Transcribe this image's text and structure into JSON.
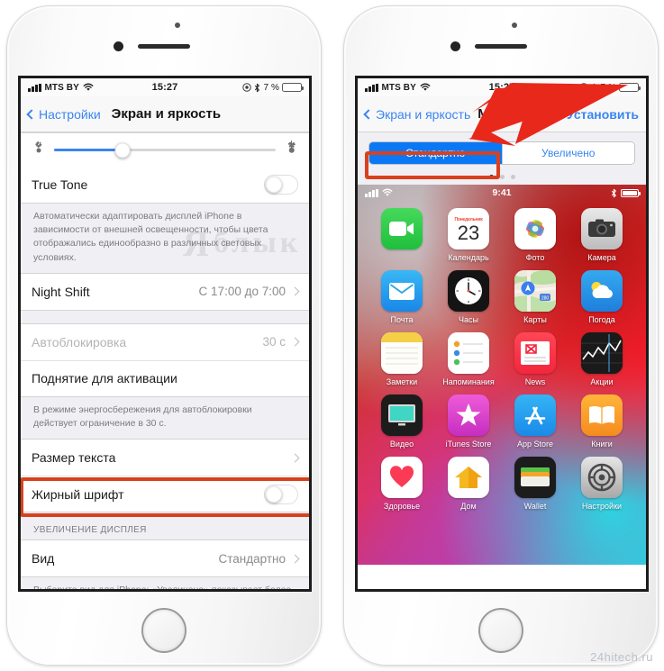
{
  "left_phone": {
    "status_bar": {
      "carrier": "MTS BY",
      "time": "15:27",
      "battery_pct": "7 %"
    },
    "nav": {
      "back_label": "Настройки",
      "title": "Экран и яркость"
    },
    "brightness": {
      "value_pct": 31,
      "low_icon": "sun-small-icon",
      "high_icon": "sun-large-icon"
    },
    "rows": {
      "true_tone": {
        "label": "True Tone",
        "toggle": "off"
      },
      "true_tone_note": "Автоматически адаптировать дисплей iPhone в зависимости от внешней освещенности, чтобы цвета отображались единообразно в различных световых условиях.",
      "night_shift": {
        "label": "Night Shift",
        "value": "С 17:00 до 7:00"
      },
      "autolock": {
        "label": "Автоблокировка",
        "value": "30 с"
      },
      "raise_to_wake": {
        "label": "Поднятие для активации"
      },
      "autolock_note": "В режиме энергосбережения для автоблокировки действует ограничение в 30 с.",
      "text_size": {
        "label": "Размер текста"
      },
      "bold_text": {
        "label": "Жирный шрифт",
        "toggle": "off"
      },
      "zoom_header": "УВЕЛИЧЕНИЕ ДИСПЛЕЯ",
      "view": {
        "label": "Вид",
        "value": "Стандартно"
      },
      "view_note": "Выберите вид для iPhone: «Увеличено» показывает более крупно элементы управления, «Стандартно» — больше контента."
    }
  },
  "right_phone": {
    "status_bar": {
      "carrier": "MTS BY",
      "time": "15:27",
      "battery_pct": "7 %"
    },
    "nav": {
      "back_label": "Экран и яркость",
      "title": "Масштаб",
      "action": "Установить"
    },
    "segmented": {
      "options": [
        "Стандартно",
        "Увеличено"
      ],
      "selected_index": 0
    },
    "page_dots": {
      "count": 3,
      "active_index": 0
    },
    "home_preview": {
      "status_bar": {
        "time": "9:41"
      },
      "apps": [
        {
          "label": "",
          "icon": "facetime-icon"
        },
        {
          "label": "Календарь",
          "icon": "calendar-icon",
          "day": "23",
          "month": "Понедельник"
        },
        {
          "label": "Фото",
          "icon": "photos-icon"
        },
        {
          "label": "Камера",
          "icon": "camera-icon"
        },
        {
          "label": "Почта",
          "icon": "mail-icon"
        },
        {
          "label": "Часы",
          "icon": "clock-icon"
        },
        {
          "label": "Карты",
          "icon": "maps-icon"
        },
        {
          "label": "Погода",
          "icon": "weather-icon"
        },
        {
          "label": "Заметки",
          "icon": "notes-icon"
        },
        {
          "label": "Напоминания",
          "icon": "reminders-icon"
        },
        {
          "label": "News",
          "icon": "news-icon"
        },
        {
          "label": "Акции",
          "icon": "stocks-icon"
        },
        {
          "label": "Видео",
          "icon": "videos-icon"
        },
        {
          "label": "iTunes Store",
          "icon": "itunes-store-icon"
        },
        {
          "label": "App Store",
          "icon": "app-store-icon"
        },
        {
          "label": "Книги",
          "icon": "books-icon"
        },
        {
          "label": "Здоровье",
          "icon": "health-icon"
        },
        {
          "label": "Дом",
          "icon": "home-icon"
        },
        {
          "label": "Wallet",
          "icon": "wallet-icon"
        },
        {
          "label": "Настройки",
          "icon": "settings-icon"
        }
      ]
    }
  },
  "annotations": {
    "highlight_color": "#d9411e",
    "arrow_color": "#e8281b",
    "accent_blue": "#0a78f5"
  },
  "watermarks": {
    "overlay": "Яблык",
    "site": "24hitech.ru"
  }
}
